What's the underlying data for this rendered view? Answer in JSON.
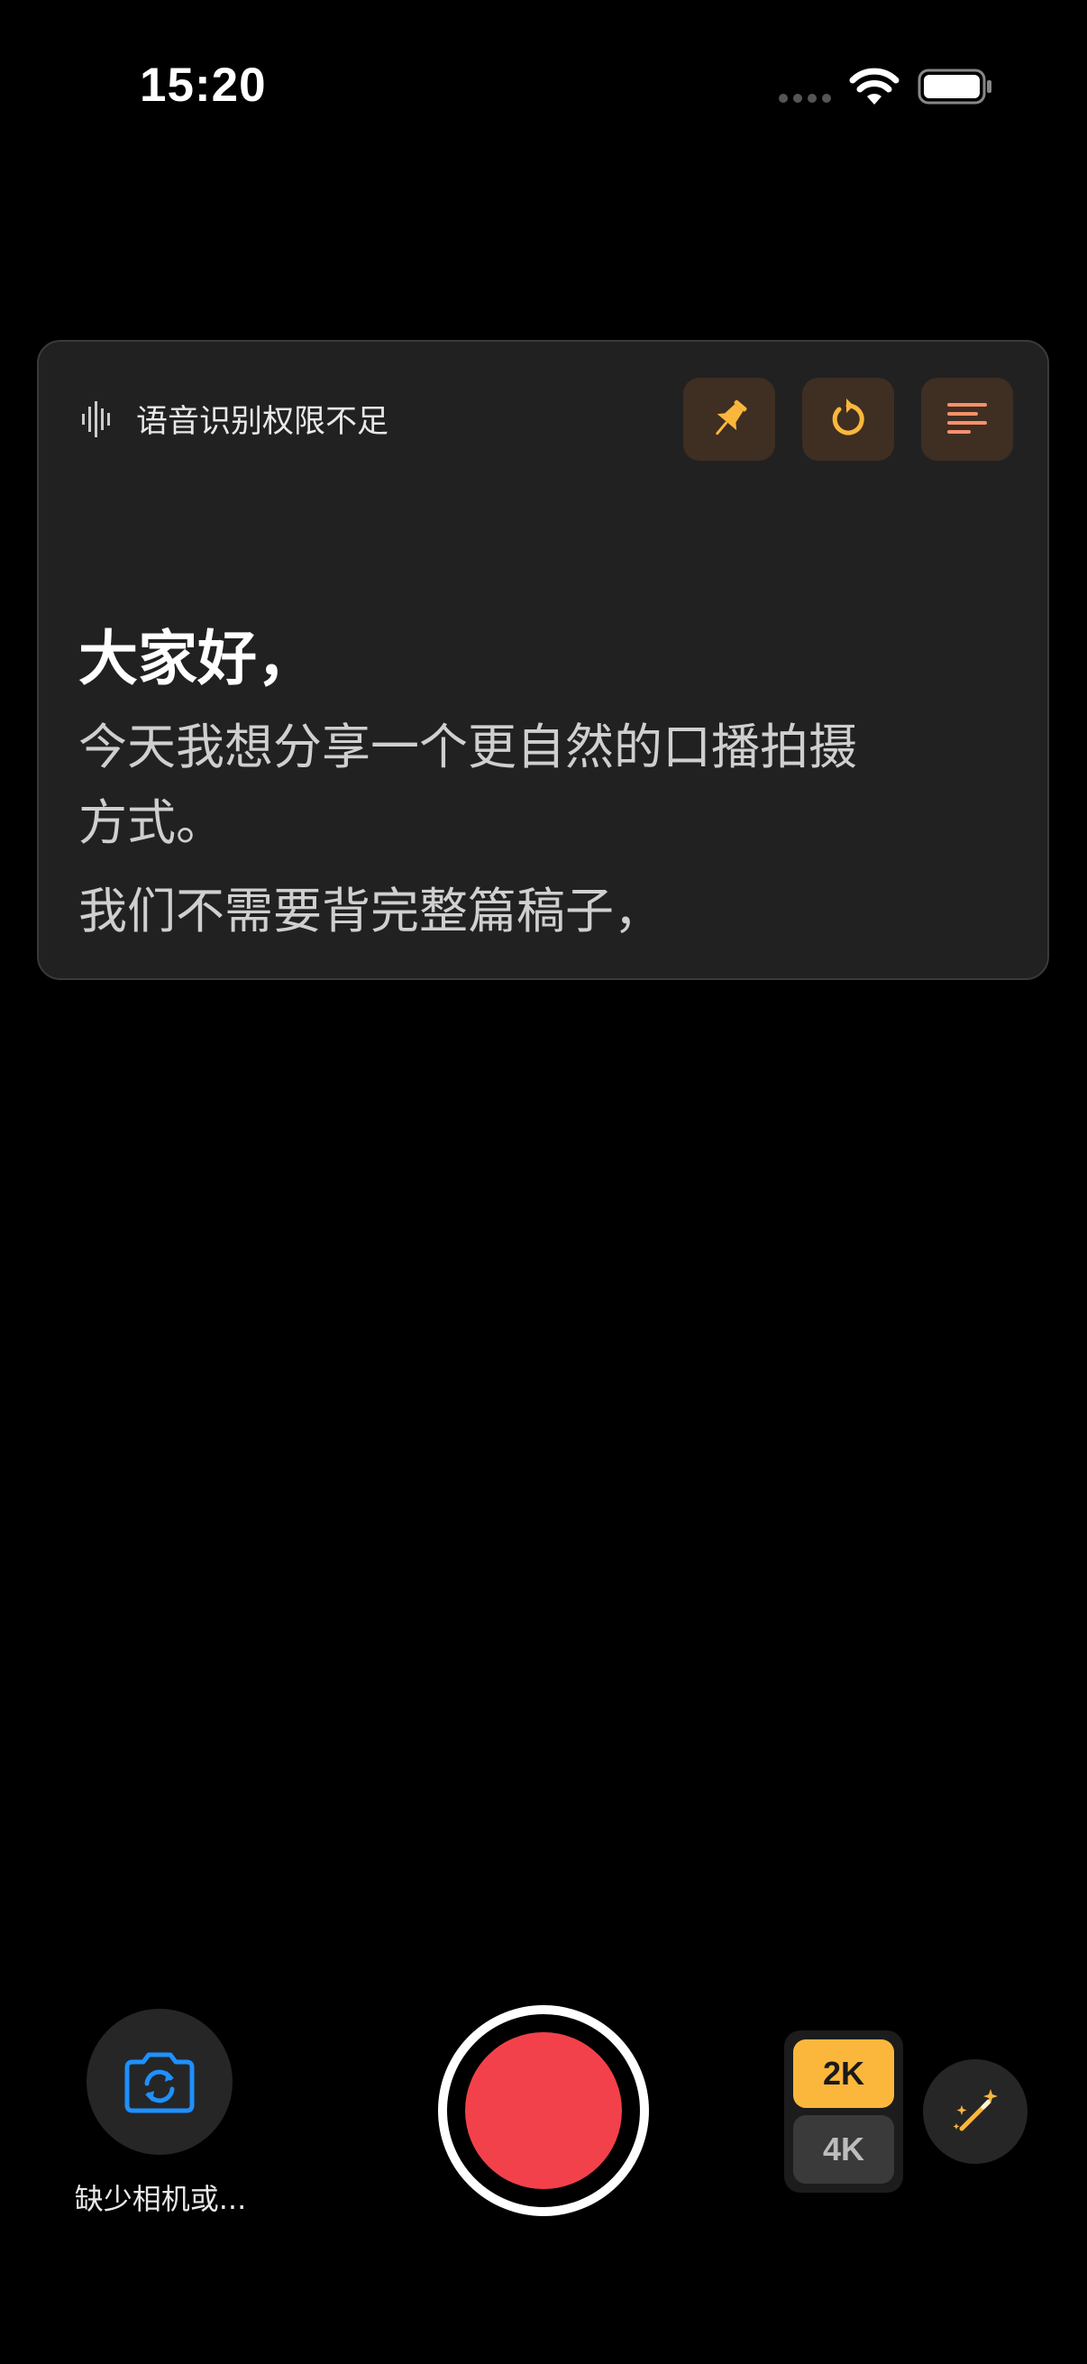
{
  "status_bar": {
    "time": "15:20"
  },
  "prompter": {
    "status_text": "语音识别权限不足",
    "heading": "大家好，",
    "lines": [
      "今天我想分享一个更自然的口播拍摄方式。",
      "我们不需要背完整篇稿子，"
    ],
    "icons": {
      "status": "waveform-icon",
      "pin": "pin-icon",
      "reset": "reset-icon",
      "align": "text-align-icon"
    },
    "accent_color": "#fbb73c"
  },
  "controls": {
    "flip_camera_label": "缺少相机或...",
    "resolution_options": [
      "2K",
      "4K"
    ],
    "selected_resolution": "2K",
    "icons": {
      "flip": "camera-flip-icon",
      "magic": "magic-wand-icon"
    },
    "record_color": "#f2414a"
  }
}
